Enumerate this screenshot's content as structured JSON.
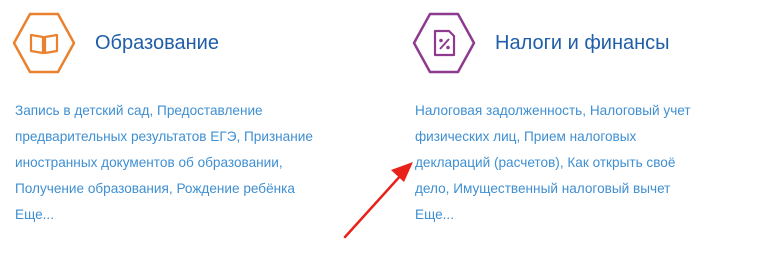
{
  "cards": [
    {
      "title": "Образование",
      "icon": "book-icon",
      "accent": "#e9812f",
      "lines": [
        "Запись в детский сад, Предоставление",
        "предварительных результатов ЕГЭ, Признание",
        "иностранных документов об образовании,",
        "Получение образования, Рождение ребёнка"
      ],
      "more": "Еще..."
    },
    {
      "title": "Налоги и финансы",
      "icon": "tax-document-icon",
      "accent": "#8e3a8f",
      "lines": [
        "Налоговая задолженность, Налоговый учет",
        "физических лиц, Прием налоговых",
        "деклараций (расчетов), Как открыть своё",
        "дело, Имущественный налоговый вычет"
      ],
      "more": "Еще..."
    }
  ],
  "colors": {
    "title": "#1f5ea8",
    "link": "#3f8fd2",
    "annotation_arrow": "#e8221b"
  }
}
